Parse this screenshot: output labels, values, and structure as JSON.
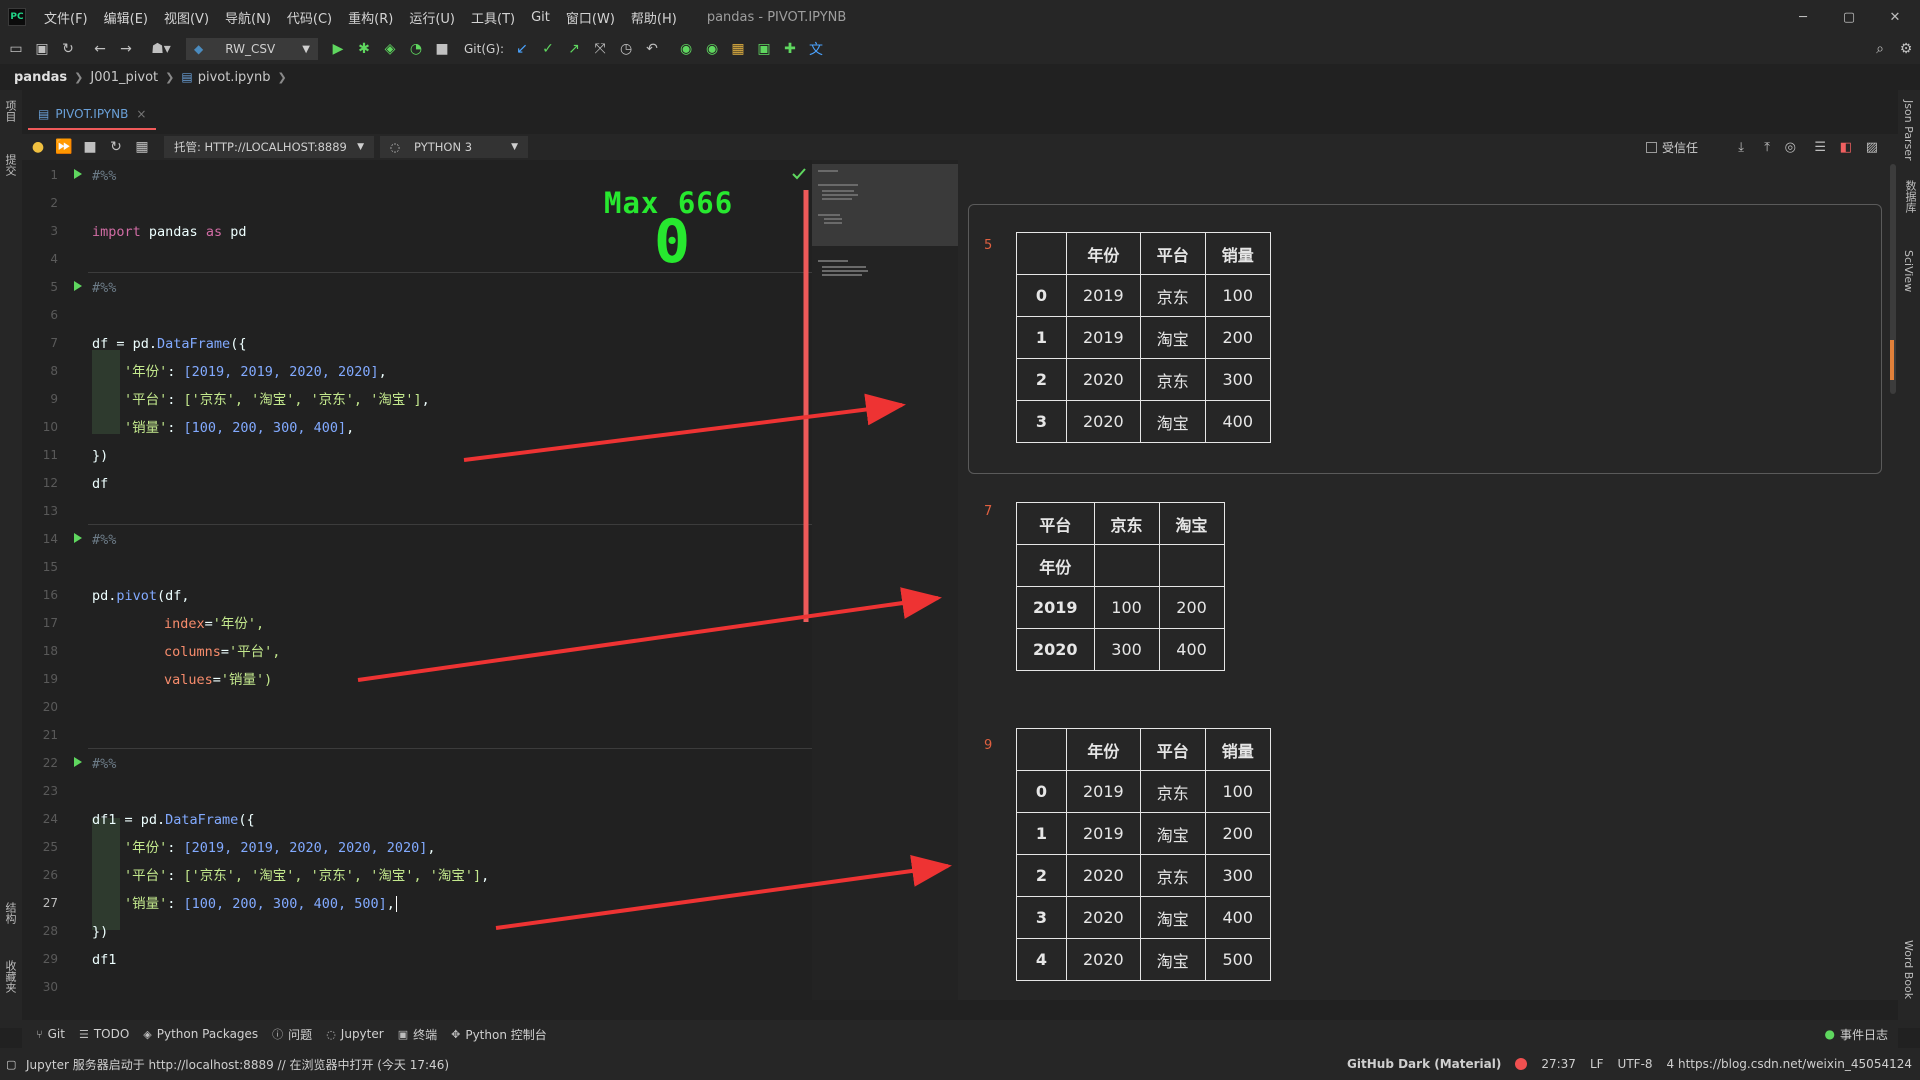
{
  "window": {
    "title": "pandas - PIVOT.IPYNB",
    "controls": {
      "minimize": "─",
      "maximize": "▢",
      "close": "✕"
    }
  },
  "menu": [
    "文件(F)",
    "编辑(E)",
    "视图(V)",
    "导航(N)",
    "代码(C)",
    "重构(R)",
    "运行(U)",
    "工具(T)",
    "Git",
    "窗口(W)",
    "帮助(H)"
  ],
  "toolbar": {
    "run_config": "RW_CSV",
    "git_label": "Git(G):"
  },
  "breadcrumb": [
    "pandas",
    "J001_pivot",
    "pivot.ipynb"
  ],
  "left_strip": {
    "project": "项目",
    "commit": "提交",
    "structure": "结构",
    "favorites": "收藏夹"
  },
  "right_strip": {
    "json_parser": "Json Parser",
    "database": "数据库",
    "sciview": "SciView",
    "word_book": "Word Book"
  },
  "tab": {
    "label": "PIVOT.IPYNB"
  },
  "notebook_bar": {
    "server": "托管: HTTP://LOCALHOST:8889",
    "kernel": "PYTHON 3",
    "trusted": "受信任"
  },
  "overlay": {
    "max_text": "Max 666",
    "score": "0"
  },
  "line_numbers": [
    "1",
    "2",
    "3",
    "4",
    "5",
    "6",
    "7",
    "8",
    "9",
    "10",
    "11",
    "12",
    "13",
    "14",
    "15",
    "16",
    "17",
    "18",
    "19",
    "20",
    "21",
    "22",
    "23",
    "24",
    "25",
    "26",
    "27",
    "28",
    "29",
    "30"
  ],
  "current_line": "27",
  "code": {
    "l1": "#%%",
    "l3_kw": "import",
    "l3_rest": " pandas ",
    "l3_as": "as",
    "l3_pd": " pd",
    "l5": "#%%",
    "l7_a": "df = pd.",
    "l7_fn": "DataFrame",
    "l7_b": "({",
    "l8_key": "'年份'",
    "l8_nums": "[2019, 2019, 2020, 2020]",
    "l9_key": "'平台'",
    "l9_vals": "['京东', '淘宝', '京东', '淘宝']",
    "l10_key": "'销量'",
    "l10_nums": "[100, 200, 300, 400]",
    "l11": "})",
    "l12": "df",
    "l14": "#%%",
    "l16_a": "pd.",
    "l16_fn": "pivot",
    "l16_b": "(df,",
    "l17_p": "index",
    "l17_v": "'年份',",
    "l18_p": "columns",
    "l18_v": "'平台',",
    "l19_p": "values",
    "l19_v": "'销量')",
    "l22": "#%%",
    "l24_a": "df1 = pd.",
    "l24_fn": "DataFrame",
    "l24_b": "({",
    "l25_key": "'年份'",
    "l25_nums": "[2019, 2019, 2020, 2020, 2020]",
    "l26_key": "'平台'",
    "l26_vals": "['京东', '淘宝', '京东', '淘宝', '淘宝']",
    "l27_key": "'销量'",
    "l27_nums": "[100, 200, 300, 400, 500]",
    "l28": "})",
    "l29": "df1"
  },
  "outputs": {
    "out1": {
      "number": "5",
      "headers": [
        "",
        "年份",
        "平台",
        "销量"
      ],
      "rows": [
        [
          "0",
          "2019",
          "京东",
          "100"
        ],
        [
          "1",
          "2019",
          "淘宝",
          "200"
        ],
        [
          "2",
          "2020",
          "京东",
          "300"
        ],
        [
          "3",
          "2020",
          "淘宝",
          "400"
        ]
      ]
    },
    "out2": {
      "number": "7",
      "headers": [
        "平台",
        "京东",
        "淘宝"
      ],
      "index_name": "年份",
      "rows": [
        [
          "2019",
          "100",
          "200"
        ],
        [
          "2020",
          "300",
          "400"
        ]
      ]
    },
    "out3": {
      "number": "9",
      "headers": [
        "",
        "年份",
        "平台",
        "销量"
      ],
      "rows": [
        [
          "0",
          "2019",
          "京东",
          "100"
        ],
        [
          "1",
          "2019",
          "淘宝",
          "200"
        ],
        [
          "2",
          "2020",
          "京东",
          "300"
        ],
        [
          "3",
          "2020",
          "淘宝",
          "400"
        ],
        [
          "4",
          "2020",
          "淘宝",
          "500"
        ]
      ]
    }
  },
  "bottom_tools": [
    "Git",
    "TODO",
    "Python Packages",
    "问题",
    "Jupyter",
    "终端",
    "Python 控制台"
  ],
  "event_log": "事件日志",
  "status": {
    "message": "Jupyter 服务器启动于 http://localhost:8889 // 在浏览器中打开 (今天 17:46)",
    "theme": "GitHub Dark (Material)",
    "position": "27:37",
    "line_sep": "LF",
    "encoding": "UTF-8",
    "right_text": "4 https://blog.csdn.net/weixin_45054124"
  },
  "colors": {
    "accent_red": "#f05a5a",
    "overlay_green": "#27e82f",
    "annotation_red": "#ee3333"
  }
}
